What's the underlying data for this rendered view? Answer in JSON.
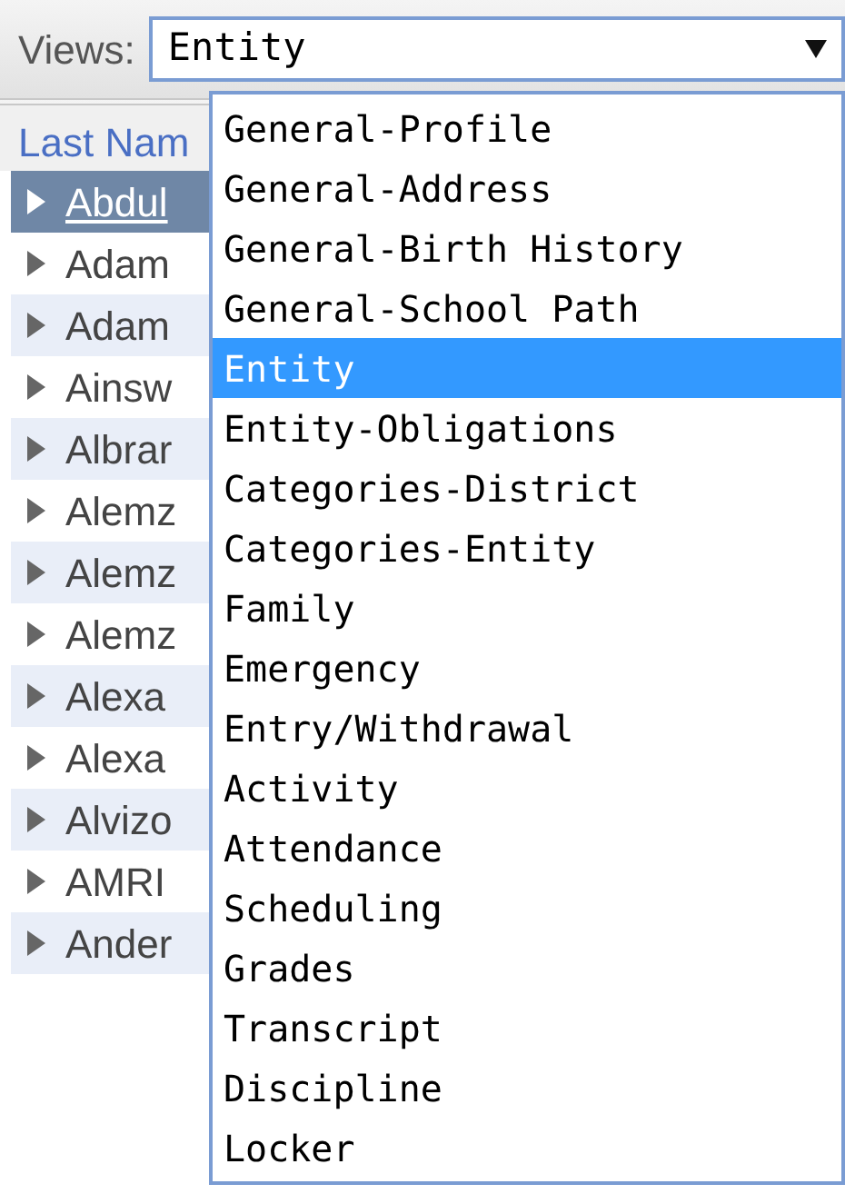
{
  "views": {
    "label": "Views:",
    "value": "Entity"
  },
  "dropdown": {
    "options": [
      {
        "label": "General-Profile",
        "selected": false
      },
      {
        "label": "General-Address",
        "selected": false
      },
      {
        "label": "General-Birth History",
        "selected": false
      },
      {
        "label": "General-School Path",
        "selected": false
      },
      {
        "label": "Entity",
        "selected": true
      },
      {
        "label": "Entity-Obligations",
        "selected": false
      },
      {
        "label": "Categories-District",
        "selected": false
      },
      {
        "label": "Categories-Entity",
        "selected": false
      },
      {
        "label": "Family",
        "selected": false
      },
      {
        "label": "Emergency",
        "selected": false
      },
      {
        "label": "Entry/Withdrawal",
        "selected": false
      },
      {
        "label": "Activity",
        "selected": false
      },
      {
        "label": "Attendance",
        "selected": false
      },
      {
        "label": "Scheduling",
        "selected": false
      },
      {
        "label": "Grades",
        "selected": false
      },
      {
        "label": "Transcript",
        "selected": false
      },
      {
        "label": "Discipline",
        "selected": false
      },
      {
        "label": "Locker",
        "selected": false
      }
    ]
  },
  "grid": {
    "column_header": "Last Nam",
    "rows": [
      {
        "name": "Abdul",
        "selected": true
      },
      {
        "name": "Adam",
        "selected": false
      },
      {
        "name": "Adam",
        "selected": false
      },
      {
        "name": "Ainsw",
        "selected": false
      },
      {
        "name": "Albrar",
        "selected": false
      },
      {
        "name": "Alemz",
        "selected": false
      },
      {
        "name": "Alemz",
        "selected": false
      },
      {
        "name": "Alemz",
        "selected": false
      },
      {
        "name": "Alexa",
        "selected": false
      },
      {
        "name": "Alexa",
        "selected": false
      },
      {
        "name": "Alvizo",
        "selected": false
      },
      {
        "name": "AMRI",
        "selected": false
      },
      {
        "name": "Ander",
        "selected": false
      }
    ]
  }
}
